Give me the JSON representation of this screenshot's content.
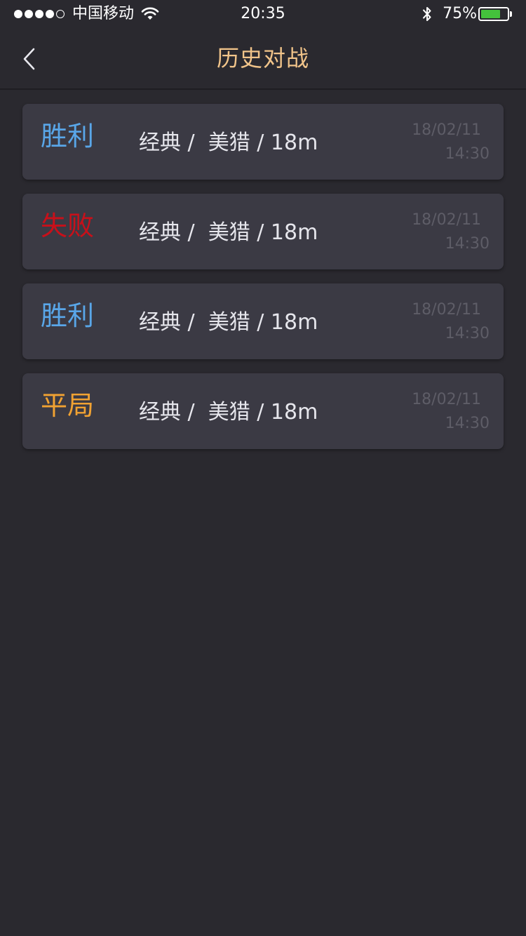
{
  "status_bar": {
    "carrier": "中国移动",
    "time": "20:35",
    "battery_percent": "75%",
    "battery_level": 0.75,
    "signal_bars_filled": 4,
    "signal_bars_total": 5,
    "icons": [
      "signal-icon",
      "wifi-icon",
      "bluetooth-icon",
      "battery-icon"
    ]
  },
  "nav": {
    "title": "历史对战",
    "back_icon": "chevron-left-icon"
  },
  "colors": {
    "win": "#59a6e8",
    "loss": "#c8101a",
    "draw": "#f1a232",
    "title": "#f1c48a",
    "background": "#2a292f",
    "card": "#3b3a44"
  },
  "matches": [
    {
      "result": "胜利",
      "result_type": "win",
      "mode": "经典 /  美猎 / 18m",
      "date": "18/02/11",
      "time": "14:30"
    },
    {
      "result": "失败",
      "result_type": "loss",
      "mode": "经典 /  美猎 / 18m",
      "date": "18/02/11",
      "time": "14:30"
    },
    {
      "result": "胜利",
      "result_type": "win",
      "mode": "经典 /  美猎 / 18m",
      "date": "18/02/11",
      "time": "14:30"
    },
    {
      "result": "平局",
      "result_type": "draw",
      "mode": "经典 /  美猎 / 18m",
      "date": "18/02/11",
      "time": "14:30"
    }
  ]
}
